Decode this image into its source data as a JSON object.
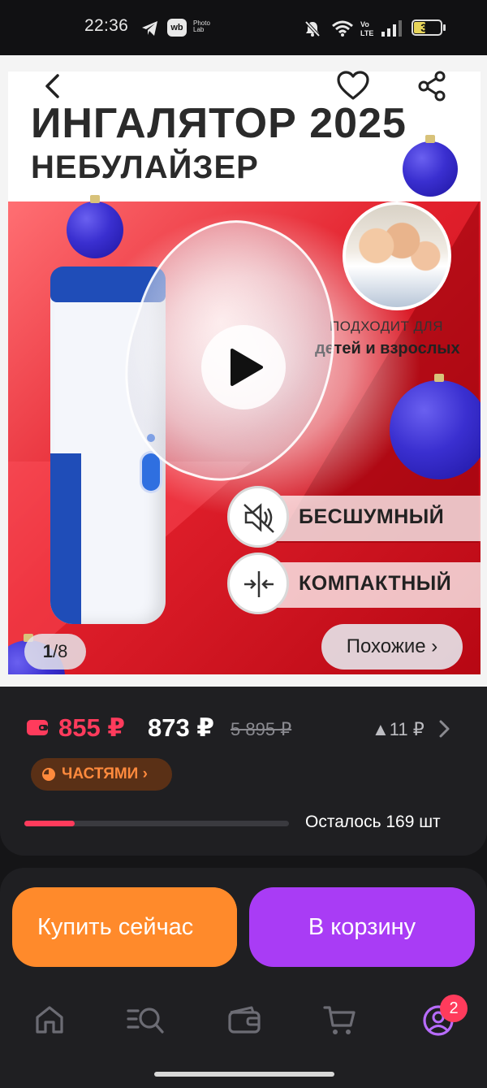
{
  "status_bar": {
    "time": "22:36",
    "app_badge": "wb",
    "photo_lab": "Photo Lab",
    "battery": "39"
  },
  "gallery": {
    "image_text": {
      "title_line1": "ИНГАЛЯТОР 2025",
      "title_line2": "НЕБУЛАЙЗЕР",
      "suits_line1": "ПОДХОДИТ ДЛЯ",
      "suits_line2": "детей и взрослых",
      "feature1": "БЕСШУМНЫЙ",
      "feature2": "КОМПАКТНЫЙ"
    },
    "counter_current": "1",
    "counter_total": "8",
    "similar_label": "Похожие ›"
  },
  "price": {
    "wallet_price": "855 ₽",
    "price": "873 ₽",
    "old_price": "5 895 ₽",
    "change": "▲11 ₽",
    "installments_label": "ЧАСТЯМИ ›",
    "stock_fraction": 0.19,
    "stock_text": "Осталось 169 шт"
  },
  "actions": {
    "buy_now": "Купить сейчас",
    "add_to_cart": "В корзину"
  },
  "bottom_nav": {
    "items": [
      "home-icon",
      "catalog-search-icon",
      "wallet-icon",
      "cart-icon",
      "profile-icon"
    ],
    "profile_badge": "2"
  },
  "colors": {
    "accent_red": "#ff3b5c",
    "buy_orange": "#ff8a2b",
    "cart_purple": "#a93cf5",
    "profile_accent": "#b86cff"
  }
}
